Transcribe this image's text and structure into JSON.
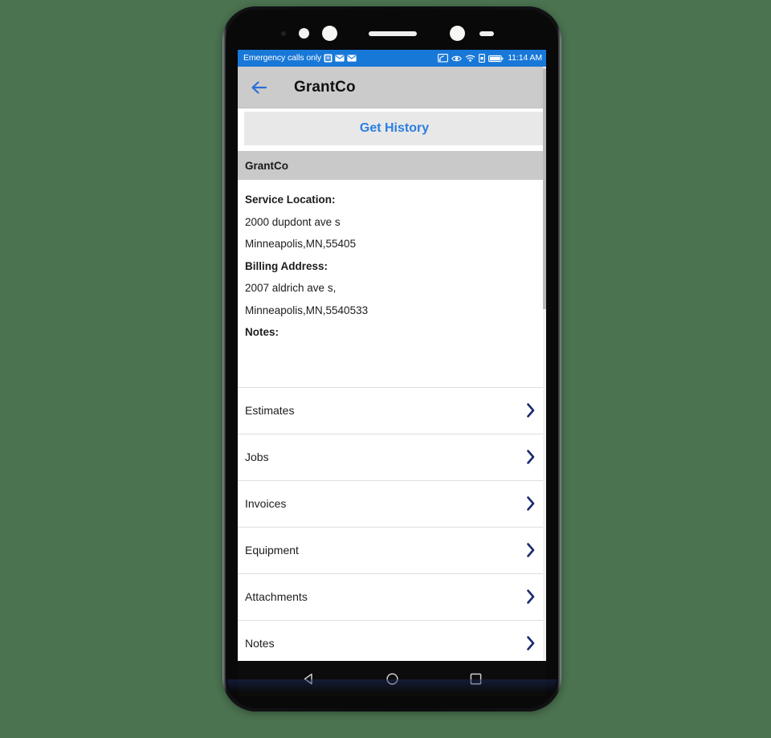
{
  "status_bar": {
    "carrier_text": "Emergency calls only",
    "time": "11:14 AM",
    "left_icons": [
      "app-notification-icon",
      "mail-icon",
      "mail-icon"
    ],
    "right_icons": [
      "cast-icon",
      "eye-icon",
      "wifi-icon",
      "sim-card-icon",
      "battery-icon"
    ],
    "background_color": "#1878d8"
  },
  "app_bar": {
    "back_label": "back-arrow",
    "title": "GrantCo",
    "background_color": "#cbcbcb",
    "accent_color": "#2a7fe0"
  },
  "actions": {
    "get_history_label": "Get History"
  },
  "section": {
    "header": "GrantCo"
  },
  "details": {
    "service_location_label": "Service Location:",
    "service_location_line1": "2000 dupdont ave s",
    "service_location_line2": "Minneapolis,MN,55405",
    "billing_address_label": "Billing Address:",
    "billing_address_line1": "2007 aldrich ave s,",
    "billing_address_line2": "Minneapolis,MN,5540533",
    "notes_label": "Notes:"
  },
  "list": {
    "chevron_color": "#1a2a6e",
    "items": [
      {
        "label": "Estimates",
        "name": "list-item-estimates"
      },
      {
        "label": "Jobs",
        "name": "list-item-jobs"
      },
      {
        "label": "Invoices",
        "name": "list-item-invoices"
      },
      {
        "label": "Equipment",
        "name": "list-item-equipment"
      },
      {
        "label": "Attachments",
        "name": "list-item-attachments"
      },
      {
        "label": "Notes",
        "name": "list-item-notes"
      }
    ]
  },
  "nav_bar": {
    "back": "android-back-icon",
    "home": "android-home-icon",
    "recents": "android-recents-icon"
  },
  "page": {
    "background_color": "#4b7350"
  }
}
